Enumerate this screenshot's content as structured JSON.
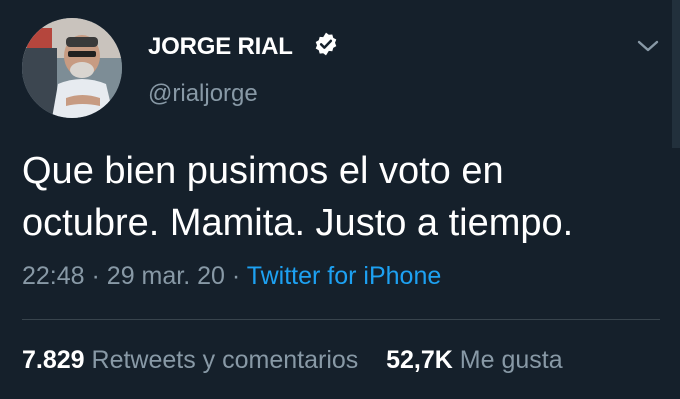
{
  "tweet": {
    "display_name": "JORGE RIAL",
    "handle": "@rialjorge",
    "verified_icon": "verified-badge-icon",
    "menu_icon": "chevron-down-icon",
    "text": "Que bien pusimos el voto en\noctubre. Mamita. Justo a tiempo.",
    "time": "22:48",
    "date": "29 mar. 20",
    "separator": "·",
    "source": "Twitter for iPhone",
    "retweets_count": "7.829",
    "retweets_label": "Retweets y comentarios",
    "likes_count": "52,7K",
    "likes_label": "Me gusta"
  },
  "colors": {
    "background": "#15202b",
    "text_primary": "#ffffff",
    "text_secondary": "#8899a6",
    "accent": "#1da1f2",
    "divider": "#38444d"
  }
}
